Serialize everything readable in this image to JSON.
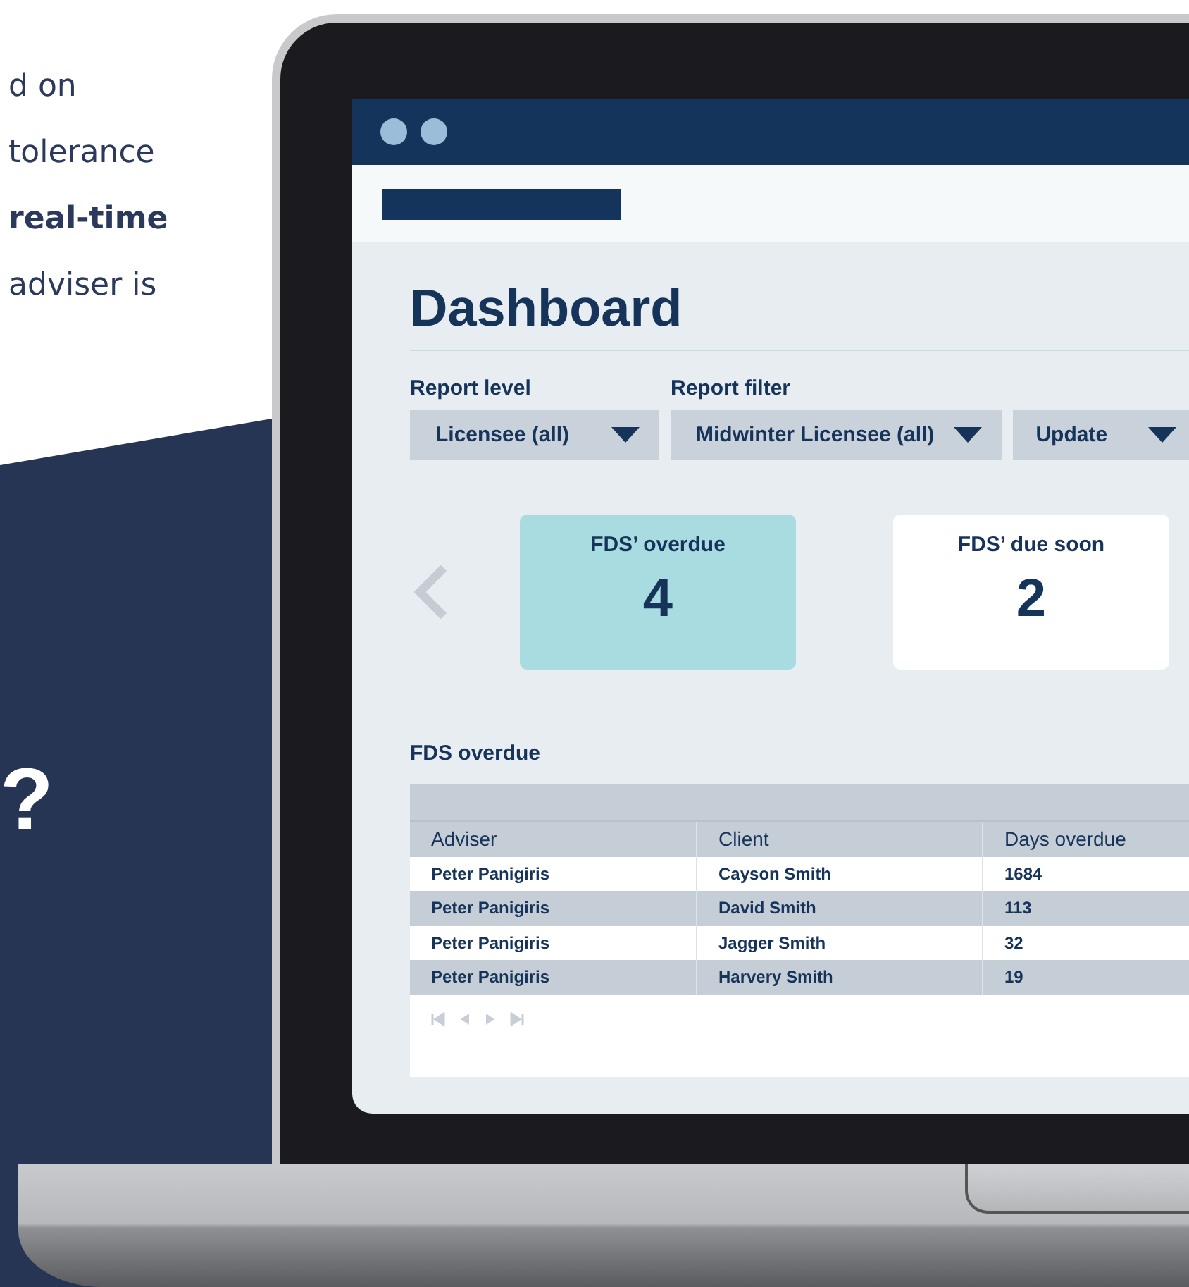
{
  "intro_text": {
    "lines": [
      "d on",
      "tolerance",
      "**real-time**",
      "adviser is"
    ]
  },
  "callout": {
    "text": "?"
  },
  "dashboard": {
    "title": "Dashboard",
    "filters": [
      {
        "label": "Report level",
        "value": "Licensee (all)"
      },
      {
        "label": "Report filter",
        "value": "Midwinter Licensee (all)"
      }
    ],
    "update_button": "Update",
    "cards": [
      {
        "title": "FDS’ overdue",
        "count": "4",
        "selected": true
      },
      {
        "title": "FDS’ due soon",
        "count": "2",
        "selected": false
      }
    ],
    "table": {
      "title": "FDS overdue",
      "columns": [
        "Adviser",
        "Client",
        "Days overdue"
      ],
      "rows": [
        [
          "Peter Panigiris",
          "Cayson Smith",
          "1684"
        ],
        [
          "Peter Panigiris",
          "David Smith",
          "113"
        ],
        [
          "Peter Panigiris",
          "Jagger Smith",
          "32"
        ],
        [
          "Peter Panigiris",
          "Harvery Smith",
          "19"
        ]
      ]
    }
  }
}
